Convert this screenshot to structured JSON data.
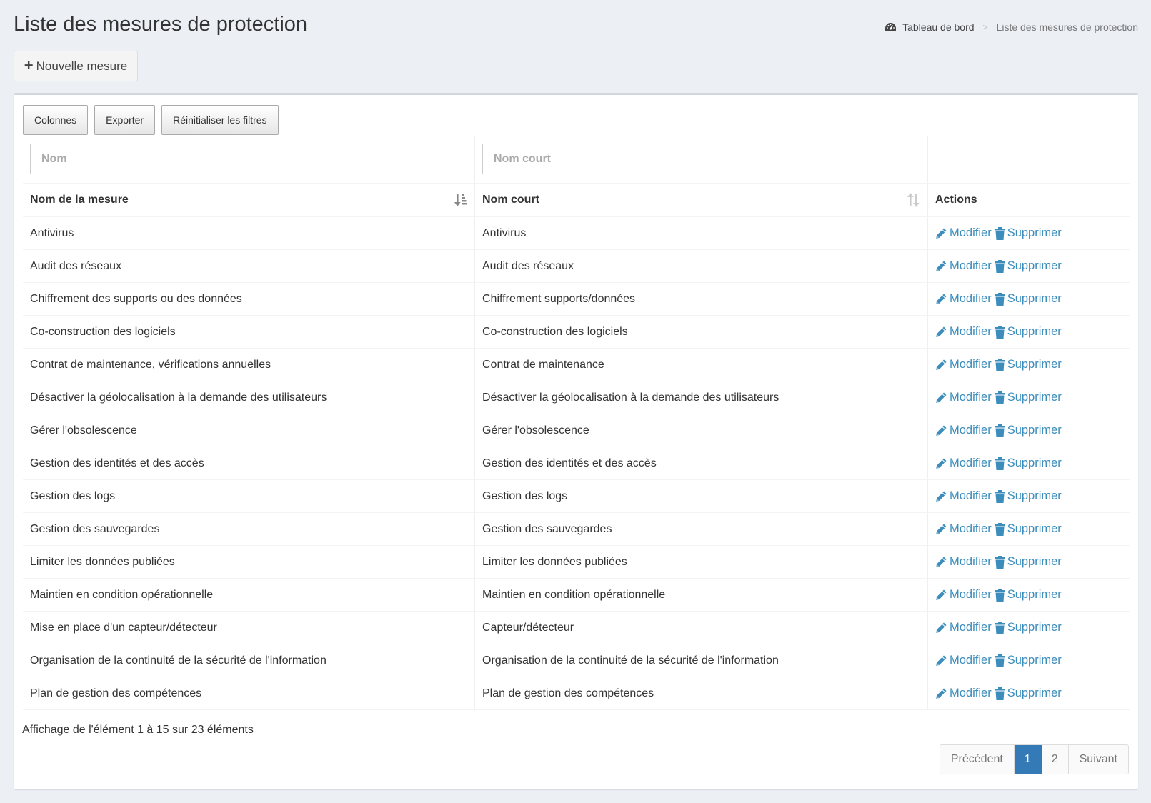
{
  "page": {
    "title": "Liste des mesures de protection"
  },
  "breadcrumb": {
    "home": "Tableau de bord",
    "separator": ">",
    "current": "Liste des mesures de protection"
  },
  "new_button": {
    "label": "Nouvelle mesure"
  },
  "toolbar": {
    "columns": "Colonnes",
    "export": "Exporter",
    "reset": "Réinitialiser les filtres"
  },
  "filters": {
    "name_placeholder": "Nom",
    "short_placeholder": "Nom court"
  },
  "table": {
    "headers": [
      "Nom de la mesure",
      "Nom court",
      "Actions"
    ],
    "edit_label": "Modifier",
    "delete_label": "Supprimer",
    "rows": [
      [
        "Antivirus",
        "Antivirus"
      ],
      [
        "Audit des réseaux",
        "Audit des réseaux"
      ],
      [
        "Chiffrement des supports ou des données",
        "Chiffrement supports/données"
      ],
      [
        "Co-construction des logiciels",
        "Co-construction des logiciels"
      ],
      [
        "Contrat de maintenance, vérifications annuelles",
        "Contrat de maintenance"
      ],
      [
        "Désactiver la géolocalisation à la demande des utilisateurs",
        "Désactiver la géolocalisation à la demande des utilisateurs"
      ],
      [
        "Gérer l'obsolescence",
        "Gérer l'obsolescence"
      ],
      [
        "Gestion des identités et des accès",
        "Gestion des identités et des accès"
      ],
      [
        "Gestion des logs",
        "Gestion des logs"
      ],
      [
        "Gestion des sauvegardes",
        "Gestion des sauvegardes"
      ],
      [
        "Limiter les données publiées",
        "Limiter les données publiées"
      ],
      [
        "Maintien en condition opérationnelle",
        "Maintien en condition opérationnelle"
      ],
      [
        "Mise en place d'un capteur/détecteur",
        "Capteur/détecteur"
      ],
      [
        "Organisation de la continuité de la sécurité de l'information",
        "Organisation de la continuité de la sécurité de l'information"
      ],
      [
        "Plan de gestion des compétences",
        "Plan de gestion des compétences"
      ]
    ]
  },
  "info": "Affichage de l'élément 1 à 15 sur 23 éléments",
  "pagination": {
    "previous": "Précédent",
    "pages": [
      "1",
      "2"
    ],
    "current_page": "1",
    "next": "Suivant"
  },
  "colors": {
    "accent": "#3c8dbc",
    "active_page": "#337ab7",
    "background": "#ecf0f5"
  }
}
